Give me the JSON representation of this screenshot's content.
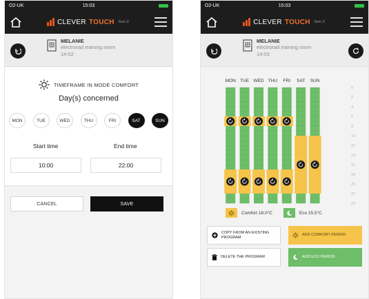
{
  "status": {
    "carrier": "O2-UK",
    "time": "15:03"
  },
  "brand": {
    "part1": "CLEVER",
    "part2": "TOUCH",
    "part3": "Gen.2"
  },
  "room": {
    "name": "MELANIE",
    "subtitle": "electrorad training room"
  },
  "left": {
    "room_time": "14:02",
    "timeframe_title": "TIMEFRAME IN MODE COMFORT",
    "days_title": "Day(s) concerned",
    "days": [
      {
        "label": "MON",
        "selected": false
      },
      {
        "label": "TUE",
        "selected": false
      },
      {
        "label": "WED",
        "selected": false
      },
      {
        "label": "THU",
        "selected": false
      },
      {
        "label": "FRI",
        "selected": false
      },
      {
        "label": "SAT",
        "selected": true
      },
      {
        "label": "SUN",
        "selected": true
      }
    ],
    "start_label": "Start time",
    "end_label": "End time",
    "start_value": "10:00",
    "end_value": "22:00",
    "cancel_label": "CANCEL",
    "save_label": "SAVE"
  },
  "right": {
    "room_time": "14:03",
    "legend": {
      "comfort": "Comfort 18.0°C",
      "eco": "Eco 15.5°C"
    },
    "copy_label": "COPY FROM AN EXISTING PROGRAM",
    "add_comfort_label": "ADD COMFORT PERIOD",
    "delete_label": "DELETE THE PROGRAM",
    "add_eco_label": "ADD ECO PERIOD"
  },
  "chart_data": {
    "type": "bar",
    "categories": [
      "MON",
      "TUE",
      "WED",
      "THU",
      "FRI",
      "SAT",
      "SUN"
    ],
    "y_ticks": [
      "0",
      "2",
      "4",
      "6",
      "8",
      "10",
      "12",
      "14",
      "16",
      "18",
      "20",
      "22",
      "24"
    ],
    "ylim": [
      0,
      24
    ],
    "series": [
      {
        "name": "Comfort 18.0°C",
        "periods": [
          {
            "day": "MON",
            "ranges": [
              [
                6,
                8
              ],
              [
                17,
                22
              ]
            ]
          },
          {
            "day": "TUE",
            "ranges": [
              [
                6,
                8
              ],
              [
                17,
                22
              ]
            ]
          },
          {
            "day": "WED",
            "ranges": [
              [
                6,
                8
              ],
              [
                17,
                22
              ]
            ]
          },
          {
            "day": "THU",
            "ranges": [
              [
                6,
                8
              ],
              [
                17,
                22
              ]
            ]
          },
          {
            "day": "FRI",
            "ranges": [
              [
                6,
                8
              ],
              [
                17,
                22
              ]
            ]
          },
          {
            "day": "SAT",
            "ranges": [
              [
                10,
                22
              ]
            ]
          },
          {
            "day": "SUN",
            "ranges": [
              [
                10,
                22
              ]
            ]
          }
        ]
      }
    ],
    "colors": {
      "comfort": "#f6c44a",
      "eco": "#6ebd68"
    }
  },
  "colors": {
    "accent": "#f4702a",
    "dark": "#1d1d1d",
    "comfort": "#f6c44a",
    "eco": "#6ebd68"
  }
}
